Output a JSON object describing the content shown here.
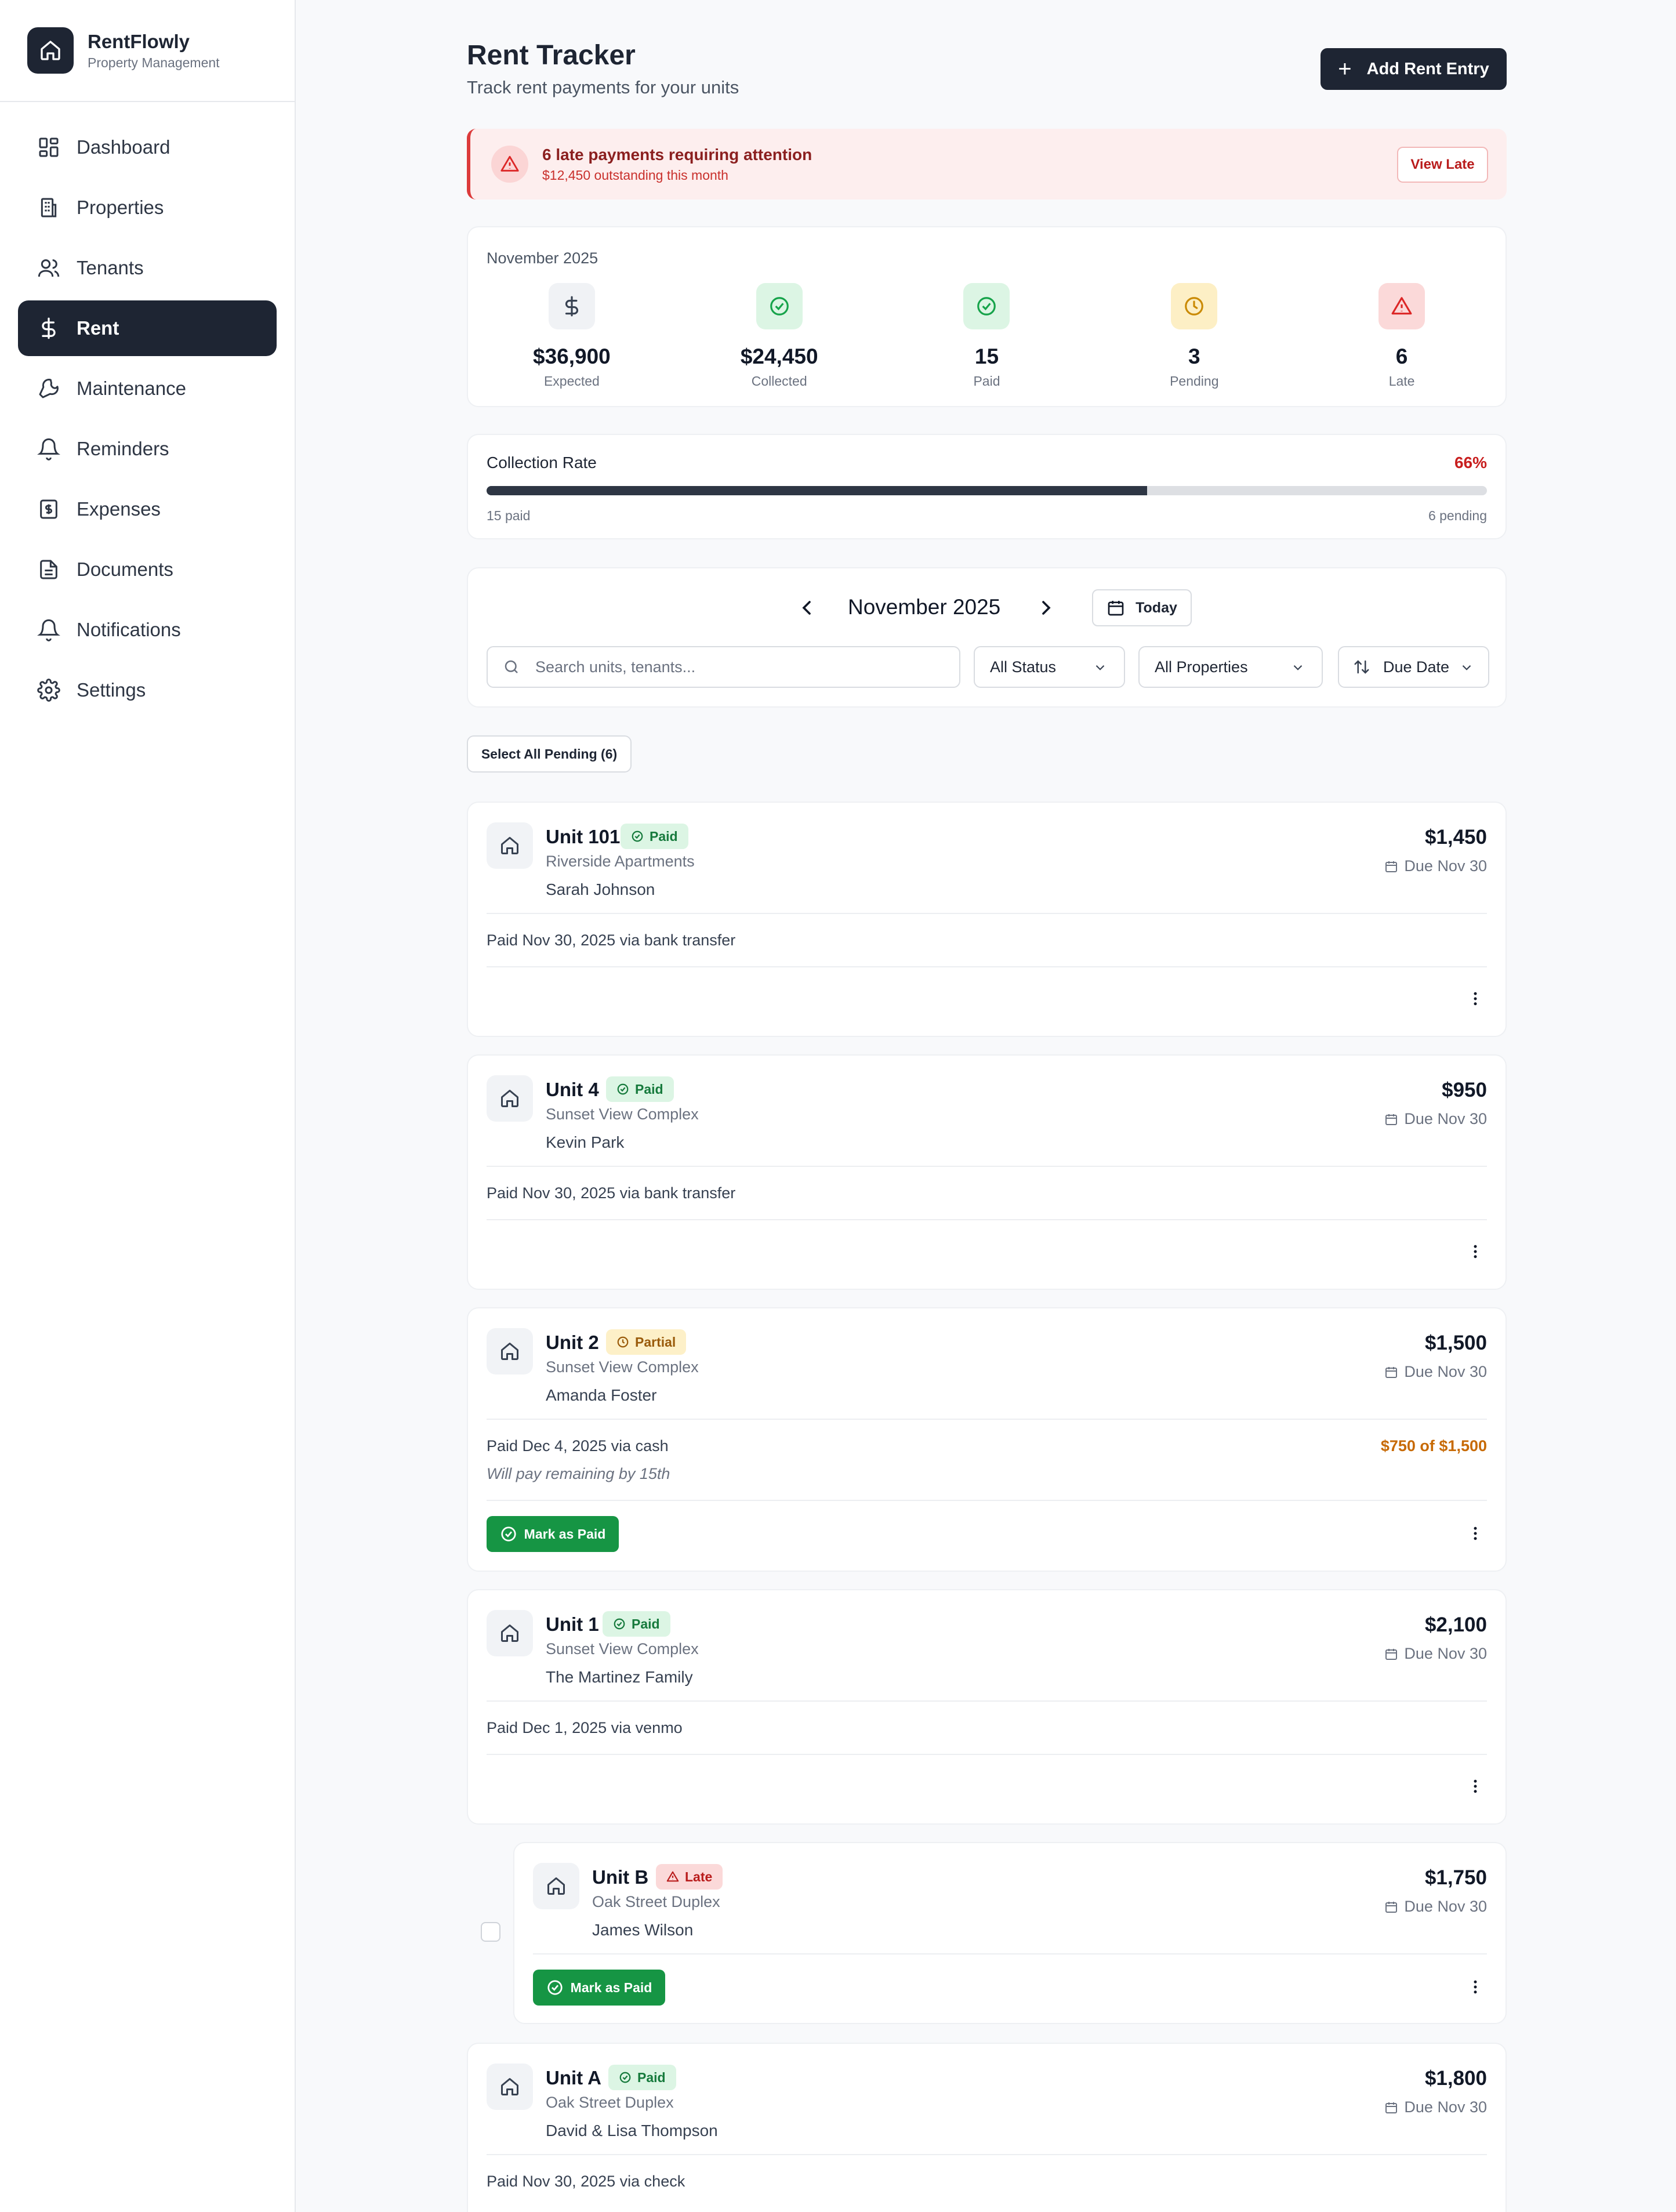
{
  "app": {
    "name": "RentFlowly",
    "subtitle": "Property Management"
  },
  "sidebar": {
    "items": [
      {
        "label": "Dashboard",
        "icon": "dashboard-icon"
      },
      {
        "label": "Properties",
        "icon": "building-icon"
      },
      {
        "label": "Tenants",
        "icon": "users-icon"
      },
      {
        "label": "Rent",
        "icon": "dollar-icon",
        "active": true
      },
      {
        "label": "Maintenance",
        "icon": "wrench-icon"
      },
      {
        "label": "Reminders",
        "icon": "bell-icon"
      },
      {
        "label": "Expenses",
        "icon": "receipt-icon"
      },
      {
        "label": "Documents",
        "icon": "document-icon"
      },
      {
        "label": "Notifications",
        "icon": "bell-icon"
      },
      {
        "label": "Settings",
        "icon": "gear-icon"
      }
    ]
  },
  "header": {
    "title": "Rent Tracker",
    "subtitle": "Track rent payments for your units",
    "add_button": "Add Rent Entry"
  },
  "alert": {
    "title": "6 late payments requiring attention",
    "subtitle": "$12,450 outstanding this month",
    "button": "View Late"
  },
  "stats": {
    "month": "November 2025",
    "items": [
      {
        "value": "$36,900",
        "label": "Expected",
        "icon": "dollar-icon"
      },
      {
        "value": "$24,450",
        "label": "Collected",
        "icon": "check-circle-icon"
      },
      {
        "value": "15",
        "label": "Paid",
        "icon": "check-circle-icon"
      },
      {
        "value": "3",
        "label": "Pending",
        "icon": "clock-icon"
      },
      {
        "value": "6",
        "label": "Late",
        "icon": "warning-icon"
      }
    ]
  },
  "collection": {
    "title": "Collection Rate",
    "percent_label": "66%",
    "percent": 66,
    "paid_label": "15 paid",
    "pending_label": "6 pending"
  },
  "filters": {
    "month": "November 2025",
    "today": "Today",
    "search_placeholder": "Search units, tenants...",
    "status": "All Status",
    "properties": "All Properties",
    "sort": "Due Date",
    "select_all": "Select All Pending (6)"
  },
  "mark_paid_label": "Mark as Paid",
  "entries": [
    {
      "unit": "Unit 101",
      "status": "Paid",
      "property": "Riverside Apartments",
      "tenant": "Sarah Johnson",
      "amount": "$1,450",
      "due": "Due Nov 30",
      "paid_info": "Paid Nov 30, 2025 via bank transfer"
    },
    {
      "unit": "Unit 4",
      "status": "Paid",
      "property": "Sunset View Complex",
      "tenant": "Kevin Park",
      "amount": "$950",
      "due": "Due Nov 30",
      "paid_info": "Paid Nov 30, 2025 via bank transfer"
    },
    {
      "unit": "Unit 2",
      "status": "Partial",
      "property": "Sunset View Complex",
      "tenant": "Amanda Foster",
      "amount": "$1,500",
      "due": "Due Nov 30",
      "paid_info": "Paid Dec 4, 2025 via cash",
      "note": "Will pay remaining by 15th",
      "partial": "$750 of $1,500"
    },
    {
      "unit": "Unit 1",
      "status": "Paid",
      "property": "Sunset View Complex",
      "tenant": "The Martinez Family",
      "amount": "$2,100",
      "due": "Due Nov 30",
      "paid_info": "Paid Dec 1, 2025 via venmo"
    },
    {
      "unit": "Unit B",
      "status": "Late",
      "property": "Oak Street Duplex",
      "tenant": "James Wilson",
      "amount": "$1,750",
      "due": "Due Nov 30"
    },
    {
      "unit": "Unit A",
      "status": "Paid",
      "property": "Oak Street Duplex",
      "tenant": "David & Lisa Thompson",
      "amount": "$1,800",
      "due": "Due Nov 30",
      "paid_info": "Paid Nov 30, 2025 via check"
    }
  ],
  "colors": {
    "primary": "#1e2533",
    "success": "#169544",
    "danger": "#dc3b3b",
    "warning": "#c76a05"
  }
}
